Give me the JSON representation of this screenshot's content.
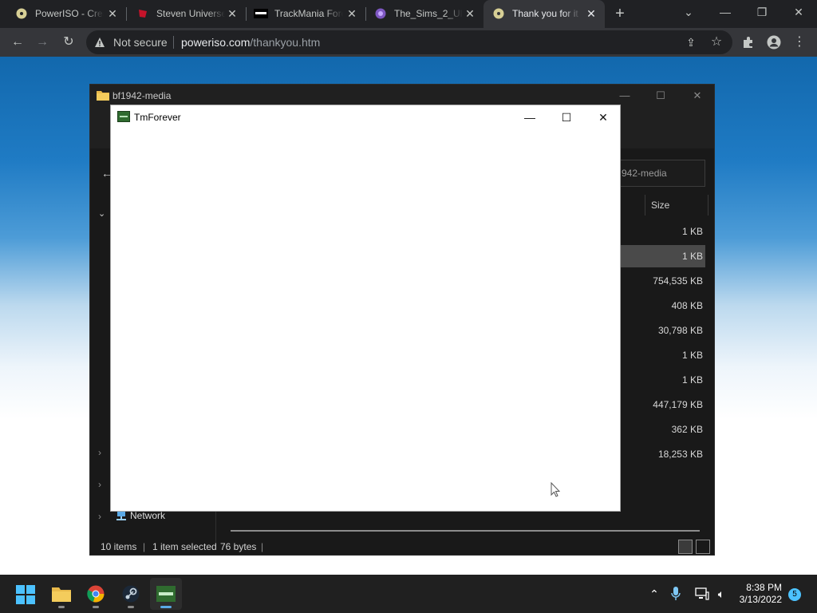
{
  "browser": {
    "tabs": [
      {
        "title": "PowerISO - Crea",
        "icon": "poweriso-disc-icon"
      },
      {
        "title": "Steven Universe",
        "icon": "steven-universe-icon"
      },
      {
        "title": "TrackMania Fore",
        "icon": "tmf-icon"
      },
      {
        "title": "The_Sims_2_Ult",
        "icon": "sims-icon"
      },
      {
        "title": "Thank you for it",
        "icon": "poweriso-disc-icon"
      }
    ],
    "active_tab": 4,
    "address": {
      "security_label": "Not secure",
      "domain": "poweriso.com",
      "path": "/thankyou.htm"
    }
  },
  "explorer": {
    "title": "bf1942-media",
    "search_placeholder": "942-media",
    "size_header": "Size",
    "sizes": [
      "1 KB",
      "1 KB",
      "754,535 KB",
      "408 KB",
      "30,798 KB",
      "1 KB",
      "1 KB",
      "447,179 KB",
      "362 KB",
      "18,253 KB"
    ],
    "selected_index": 1,
    "nav": {
      "network_label": "Network"
    },
    "status": {
      "items": "10 items",
      "selected": "1 item selected",
      "size": "76 bytes"
    }
  },
  "tmforever": {
    "title": "TmForever"
  },
  "taskbar": {
    "clock_time": "8:38 PM",
    "clock_date": "3/13/2022",
    "notifications": "5"
  }
}
